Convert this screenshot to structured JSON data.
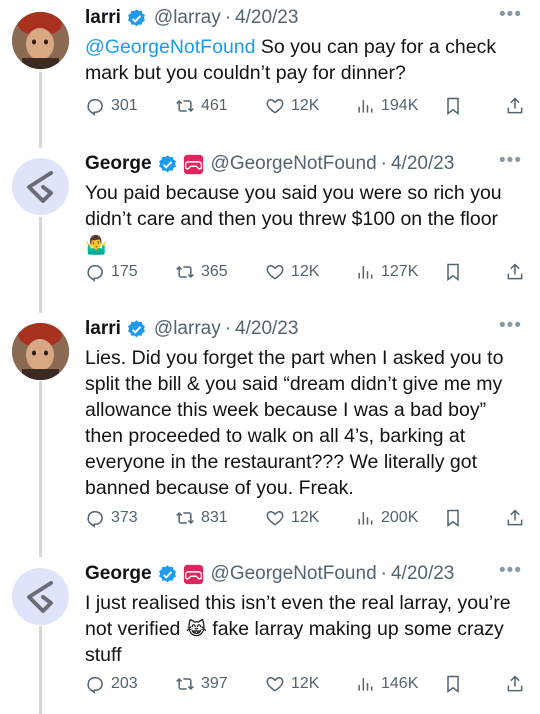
{
  "tweets": [
    {
      "name": "larri",
      "handle": "@larray",
      "separator": "·",
      "date": "4/20/23",
      "mention": "@GeorgeNotFound",
      "text": " So you can pay for a check mark but you couldn’t pay for dinner?",
      "replies": "301",
      "retweets": "461",
      "likes": "12K",
      "views": "194K"
    },
    {
      "name": "George",
      "handle": "@GeorgeNotFound",
      "separator": "·",
      "date": "4/20/23",
      "text": "You paid because you said you were so rich you didn’t care and then you threw $100 on the floor",
      "emoji": "🤷‍♂️",
      "replies": "175",
      "retweets": "365",
      "likes": "12K",
      "views": "127K"
    },
    {
      "name": "larri",
      "handle": "@larray",
      "separator": "·",
      "date": "4/20/23",
      "text": "Lies. Did you forget the part when I asked you to split the bill & you said “dream didn’t give me my allowance this week because I was a bad boy” then proceeded to walk on all 4’s, barking at everyone in the restaurant??? We literally got banned because of you. Freak.",
      "replies": "373",
      "retweets": "831",
      "likes": "12K",
      "views": "200K"
    },
    {
      "name": "George",
      "handle": "@GeorgeNotFound",
      "separator": "·",
      "date": "4/20/23",
      "text_before": "I just realised this isn’t even the real larray, you’re not verified ",
      "emoji": "😹",
      "text_after": " fake larray making up some crazy stuff",
      "replies": "203",
      "retweets": "397",
      "likes": "12K",
      "views": "146K"
    }
  ],
  "icons": {
    "more": "more-dots-icon",
    "reply": "reply-icon",
    "retweet": "retweet-icon",
    "like": "heart-icon",
    "views": "views-icon",
    "bookmark": "bookmark-icon",
    "share": "share-icon",
    "verified": "verified-badge-icon",
    "affiliate": "gamepad-badge-icon"
  },
  "colors": {
    "link": "#1d9bf0",
    "secondary": "#536471",
    "thread_line": "#cfd9de",
    "affiliate_badge": "#e0245e"
  }
}
